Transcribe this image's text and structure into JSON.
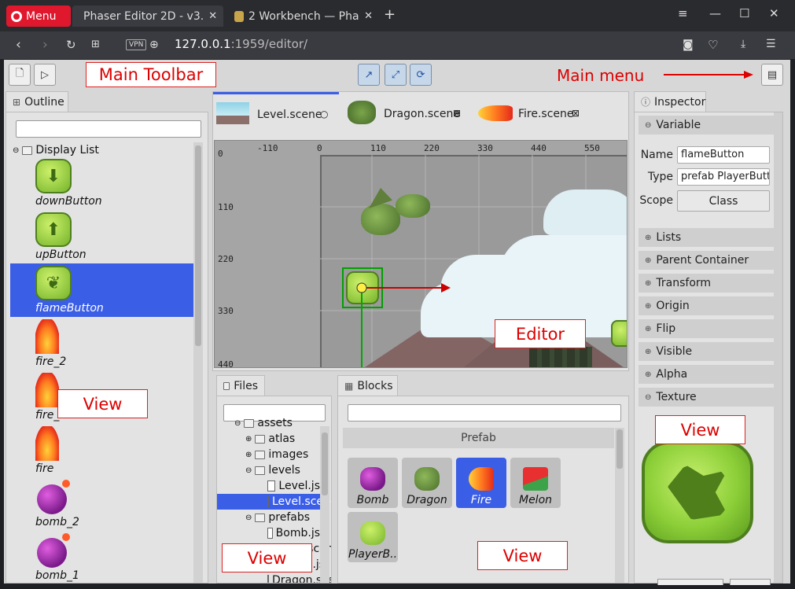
{
  "browser": {
    "menu_label": "Menu",
    "tabs": [
      {
        "title": "Phaser Editor 2D - v3.",
        "active": true
      },
      {
        "title": "2  Workbench — Pha",
        "active": false
      }
    ],
    "url_host": "127.0.0.1",
    "url_rest": ":1959/editor/",
    "vpn_label": "VPN"
  },
  "toolbar": {
    "main_toolbar_callout": "Main Toolbar",
    "main_menu_callout": "Main menu"
  },
  "outline": {
    "tab_label": "Outline",
    "root_label": "Display List",
    "items": [
      {
        "label": "downButton",
        "kind": "down"
      },
      {
        "label": "upButton",
        "kind": "up"
      },
      {
        "label": "flameButton",
        "kind": "flame-btn",
        "selected": true
      },
      {
        "label": "fire_2",
        "kind": "fire"
      },
      {
        "label": "fire_1",
        "kind": "fire"
      },
      {
        "label": "fire",
        "kind": "fire"
      },
      {
        "label": "bomb_2",
        "kind": "bomb"
      },
      {
        "label": "bomb_1",
        "kind": "bomb"
      }
    ],
    "view_callout": "View"
  },
  "editor": {
    "tabs": [
      {
        "label": "Level.scene",
        "active": true,
        "close": "○"
      },
      {
        "label": "Dragon.scene",
        "active": false,
        "close": "⊠"
      },
      {
        "label": "Fire.scene",
        "active": false,
        "close": "⊠"
      }
    ],
    "ruler_x": [
      "-110",
      "0",
      "110",
      "220",
      "330",
      "440",
      "550"
    ],
    "ruler_y": [
      "0",
      "110",
      "220",
      "330",
      "440"
    ],
    "editor_callout": "Editor"
  },
  "files": {
    "tab_label": "Files",
    "items": [
      {
        "label": "assets",
        "depth": 1,
        "type": "folder"
      },
      {
        "label": "atlas",
        "depth": 2,
        "type": "folder"
      },
      {
        "label": "images",
        "depth": 2,
        "type": "folder"
      },
      {
        "label": "levels",
        "depth": 2,
        "type": "folder"
      },
      {
        "label": "Level.js",
        "depth": 3,
        "type": "file"
      },
      {
        "label": "Level.scene",
        "depth": 3,
        "type": "file",
        "selected": true
      },
      {
        "label": "prefabs",
        "depth": 2,
        "type": "folder"
      },
      {
        "label": "Bomb.js",
        "depth": 3,
        "type": "file"
      },
      {
        "label": "Bomb.scene",
        "depth": 3,
        "type": "file"
      },
      {
        "label": "Dragon.js",
        "depth": 3,
        "type": "file"
      },
      {
        "label": "Dragon.scene",
        "depth": 3,
        "type": "file"
      }
    ],
    "view_callout": "View"
  },
  "blocks": {
    "tab_label": "Blocks",
    "section": "Prefab",
    "items": [
      {
        "label": "Bomb"
      },
      {
        "label": "Dragon"
      },
      {
        "label": "Fire",
        "selected": true
      },
      {
        "label": "Melon"
      },
      {
        "label": "PlayerB.."
      }
    ],
    "view_callout": "View"
  },
  "inspector": {
    "tab_label": "Inspector",
    "variable_section": "Variable",
    "name_label": "Name",
    "name_value": "flameButton",
    "type_label": "Type",
    "type_value": "prefab PlayerButto",
    "scope_label": "Scope",
    "scope_value": "Class",
    "sections": [
      "Lists",
      "Parent Container",
      "Transform",
      "Origin",
      "Flip",
      "Visible",
      "Alpha"
    ],
    "texture_section": "Texture",
    "view_callout": "View"
  },
  "colors": {
    "selection": "#3b5ee7",
    "callout_red": "#d00000",
    "browser_accent": "#e0182d"
  }
}
